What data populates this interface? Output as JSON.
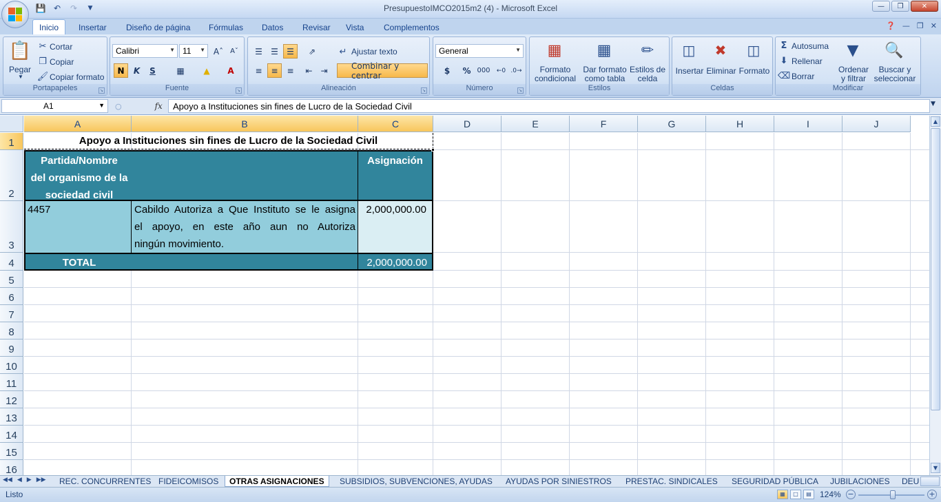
{
  "window": {
    "title": "PresupuestoIMCO2015m2 (4) - Microsoft Excel"
  },
  "ribbon": {
    "tabs": [
      "Inicio",
      "Insertar",
      "Diseño de página",
      "Fórmulas",
      "Datos",
      "Revisar",
      "Vista",
      "Complementos"
    ],
    "active_tab": "Inicio",
    "clipboard": {
      "paste": "Pegar",
      "cut": "Cortar",
      "copy": "Copiar",
      "format_painter": "Copiar formato",
      "label": "Portapapeles"
    },
    "font": {
      "name": "Calibri",
      "size": "11",
      "bold": "N",
      "italic": "K",
      "underline": "S",
      "label": "Fuente"
    },
    "alignment": {
      "wrap": "Ajustar texto",
      "merge": "Combinar y centrar",
      "label": "Alineación"
    },
    "number": {
      "format": "General",
      "currency": "$",
      "percent": "%",
      "thousands": "000",
      "label": "Número"
    },
    "styles": {
      "conditional_1": "Formato",
      "conditional_2": "condicional",
      "table_1": "Dar formato",
      "table_2": "como tabla",
      "cell_1": "Estilos de",
      "cell_2": "celda",
      "label": "Estilos"
    },
    "cells": {
      "insert": "Insertar",
      "delete": "Eliminar",
      "format": "Formato",
      "label": "Celdas"
    },
    "editing": {
      "autosum": "Autosuma",
      "fill": "Rellenar",
      "clear": "Borrar",
      "sort_1": "Ordenar",
      "sort_2": "y filtrar",
      "find_1": "Buscar y",
      "find_2": "seleccionar",
      "label": "Modificar"
    }
  },
  "formula_bar": {
    "name_box": "A1",
    "fx": "fx",
    "content": "Apoyo a Instituciones sin fines de Lucro de la Sociedad Civil"
  },
  "grid": {
    "columns": [
      "A",
      "B",
      "C",
      "D",
      "E",
      "F",
      "G",
      "H",
      "I",
      "J"
    ],
    "rows": [
      "1",
      "2",
      "3",
      "4",
      "5",
      "6",
      "7",
      "8",
      "9",
      "10",
      "11",
      "12",
      "13",
      "14",
      "15",
      "16"
    ],
    "cells": {
      "title": "Apoyo a Instituciones sin fines de Lucro de la Sociedad Civil",
      "header_partida_1": "Partida/Nombre",
      "header_partida_2": "del organismo de la",
      "header_partida_3": "sociedad civil",
      "header_asignacion": "Asignación",
      "partida": "4457",
      "desc_1": "Cabildo Autoriza a Que Instituto se le asigna",
      "desc_2": "el apoyo, en este año aun no Autoriza",
      "desc_3": "ningún movimiento.",
      "monto": "2,000,000.00",
      "total_label": "TOTAL",
      "total_monto": "2,000,000.00"
    },
    "colors": {
      "header_fill": "#31859c",
      "partida_fill": "#92cddc",
      "desc_fill": "#92cddc",
      "monto_fill": "#daeef3",
      "total_fill": "#31859c"
    }
  },
  "sheets": [
    "REC. CONCURRENTES",
    "FIDEICOMISOS",
    "OTRAS ASIGNACIONES",
    "SUBSIDIOS, SUBVENCIONES, AYUDAS",
    "AYUDAS POR SINIESTROS",
    "PRESTAC. SINDICALES",
    "SEGURIDAD PÚBLICA",
    "JUBILACIONES",
    "DEU"
  ],
  "active_sheet": "OTRAS ASIGNACIONES",
  "status": {
    "mode": "Listo",
    "zoom": "124%"
  }
}
